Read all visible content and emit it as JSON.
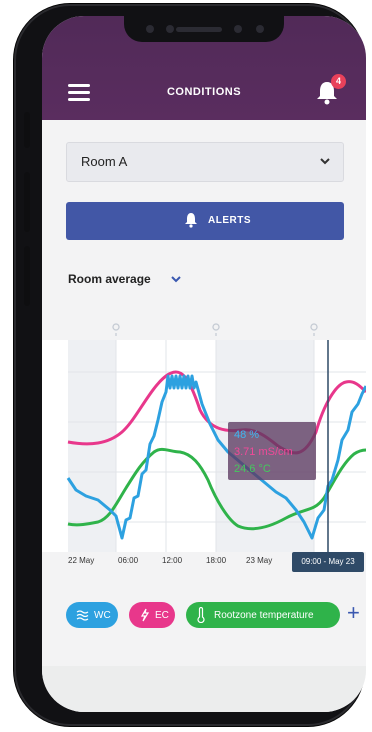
{
  "header": {
    "title": "CONDITIONS",
    "notification_count": "4"
  },
  "room_select": {
    "value": "Room A"
  },
  "alerts_button": {
    "label": "ALERTS"
  },
  "view_select": {
    "value": "Room average"
  },
  "tooltip": {
    "humidity": "48 %",
    "ec": "3.71 mS/cm",
    "temperature": "24.6 °C"
  },
  "timeline": {
    "labels": [
      "22 May",
      "06:00",
      "12:00",
      "18:00",
      "23 May"
    ],
    "current": "09:00 - May 23"
  },
  "chips": [
    {
      "label": "WC",
      "icon": "water-content-icon",
      "color": "#2da1e0"
    },
    {
      "label": "EC",
      "icon": "lightning-icon",
      "color": "#e8378b"
    },
    {
      "label": "Rootzone temperature",
      "icon": "thermometer-icon",
      "color": "#2fb34a"
    }
  ],
  "colors": {
    "header": "#512a58",
    "accent": "#4257a6",
    "wc": "#2da1e0",
    "ec": "#e8378b",
    "temp": "#2fb34a"
  }
}
